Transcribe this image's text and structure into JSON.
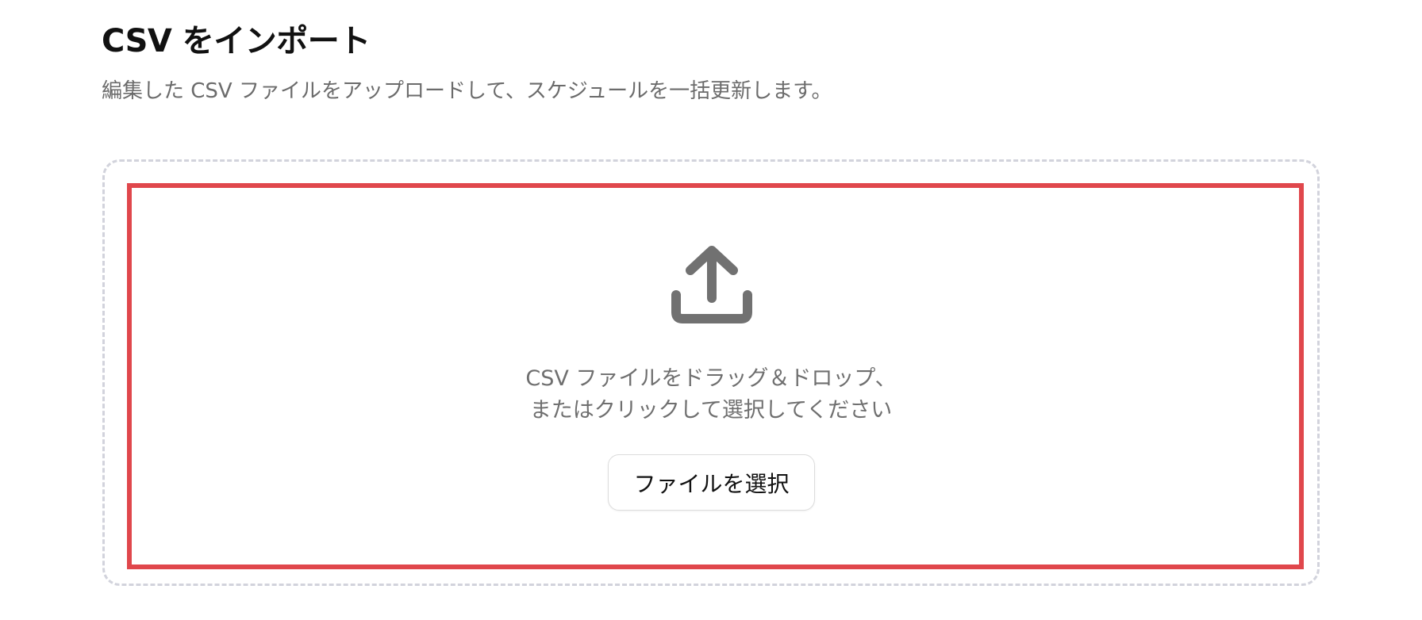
{
  "header": {
    "title": "CSV をインポート",
    "subtitle": "編集した CSV ファイルをアップロードして、スケジュールを一括更新します。"
  },
  "dropzone": {
    "icon": "upload-icon",
    "instruction_line1": "CSV ファイルをドラッグ＆ドロップ、",
    "instruction_line2": "またはクリックして選択してください",
    "button_label": "ファイルを選択",
    "border_color": "#d2d3dc",
    "highlight_color": "#e0474c",
    "icon_color": "#717171"
  }
}
